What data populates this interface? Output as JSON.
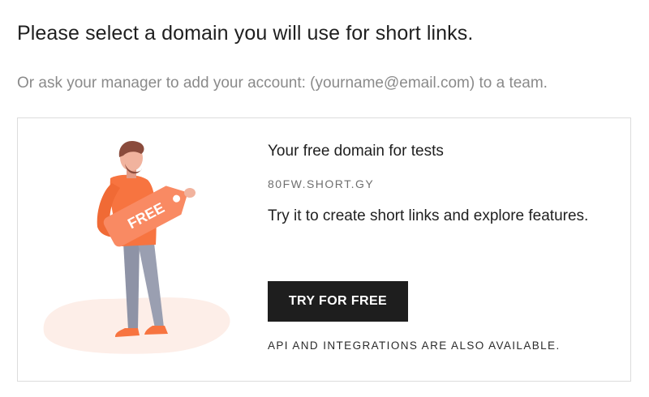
{
  "header": {
    "title": "Please select a domain you will use for short links.",
    "subtitle": "Or ask your manager to add your account: (yourname@email.com) to a team."
  },
  "card": {
    "illustration": {
      "tag_text": "FREE",
      "icon": "person-holding-free-tag-icon",
      "colors": {
        "shirt": "#f77440",
        "pants": "#8e93a6",
        "blob": "#fdeee8"
      }
    },
    "title": "Your free domain for tests",
    "domain": "80FW.SHORT.GY",
    "description": "Try it to create short links and explore features.",
    "button_label": "TRY FOR FREE",
    "note": "API AND INTEGRATIONS ARE ALSO AVAILABLE."
  },
  "colors": {
    "button_bg": "#1e1e1e",
    "accent": "#f77440",
    "muted_text": "#8a8a8a"
  }
}
